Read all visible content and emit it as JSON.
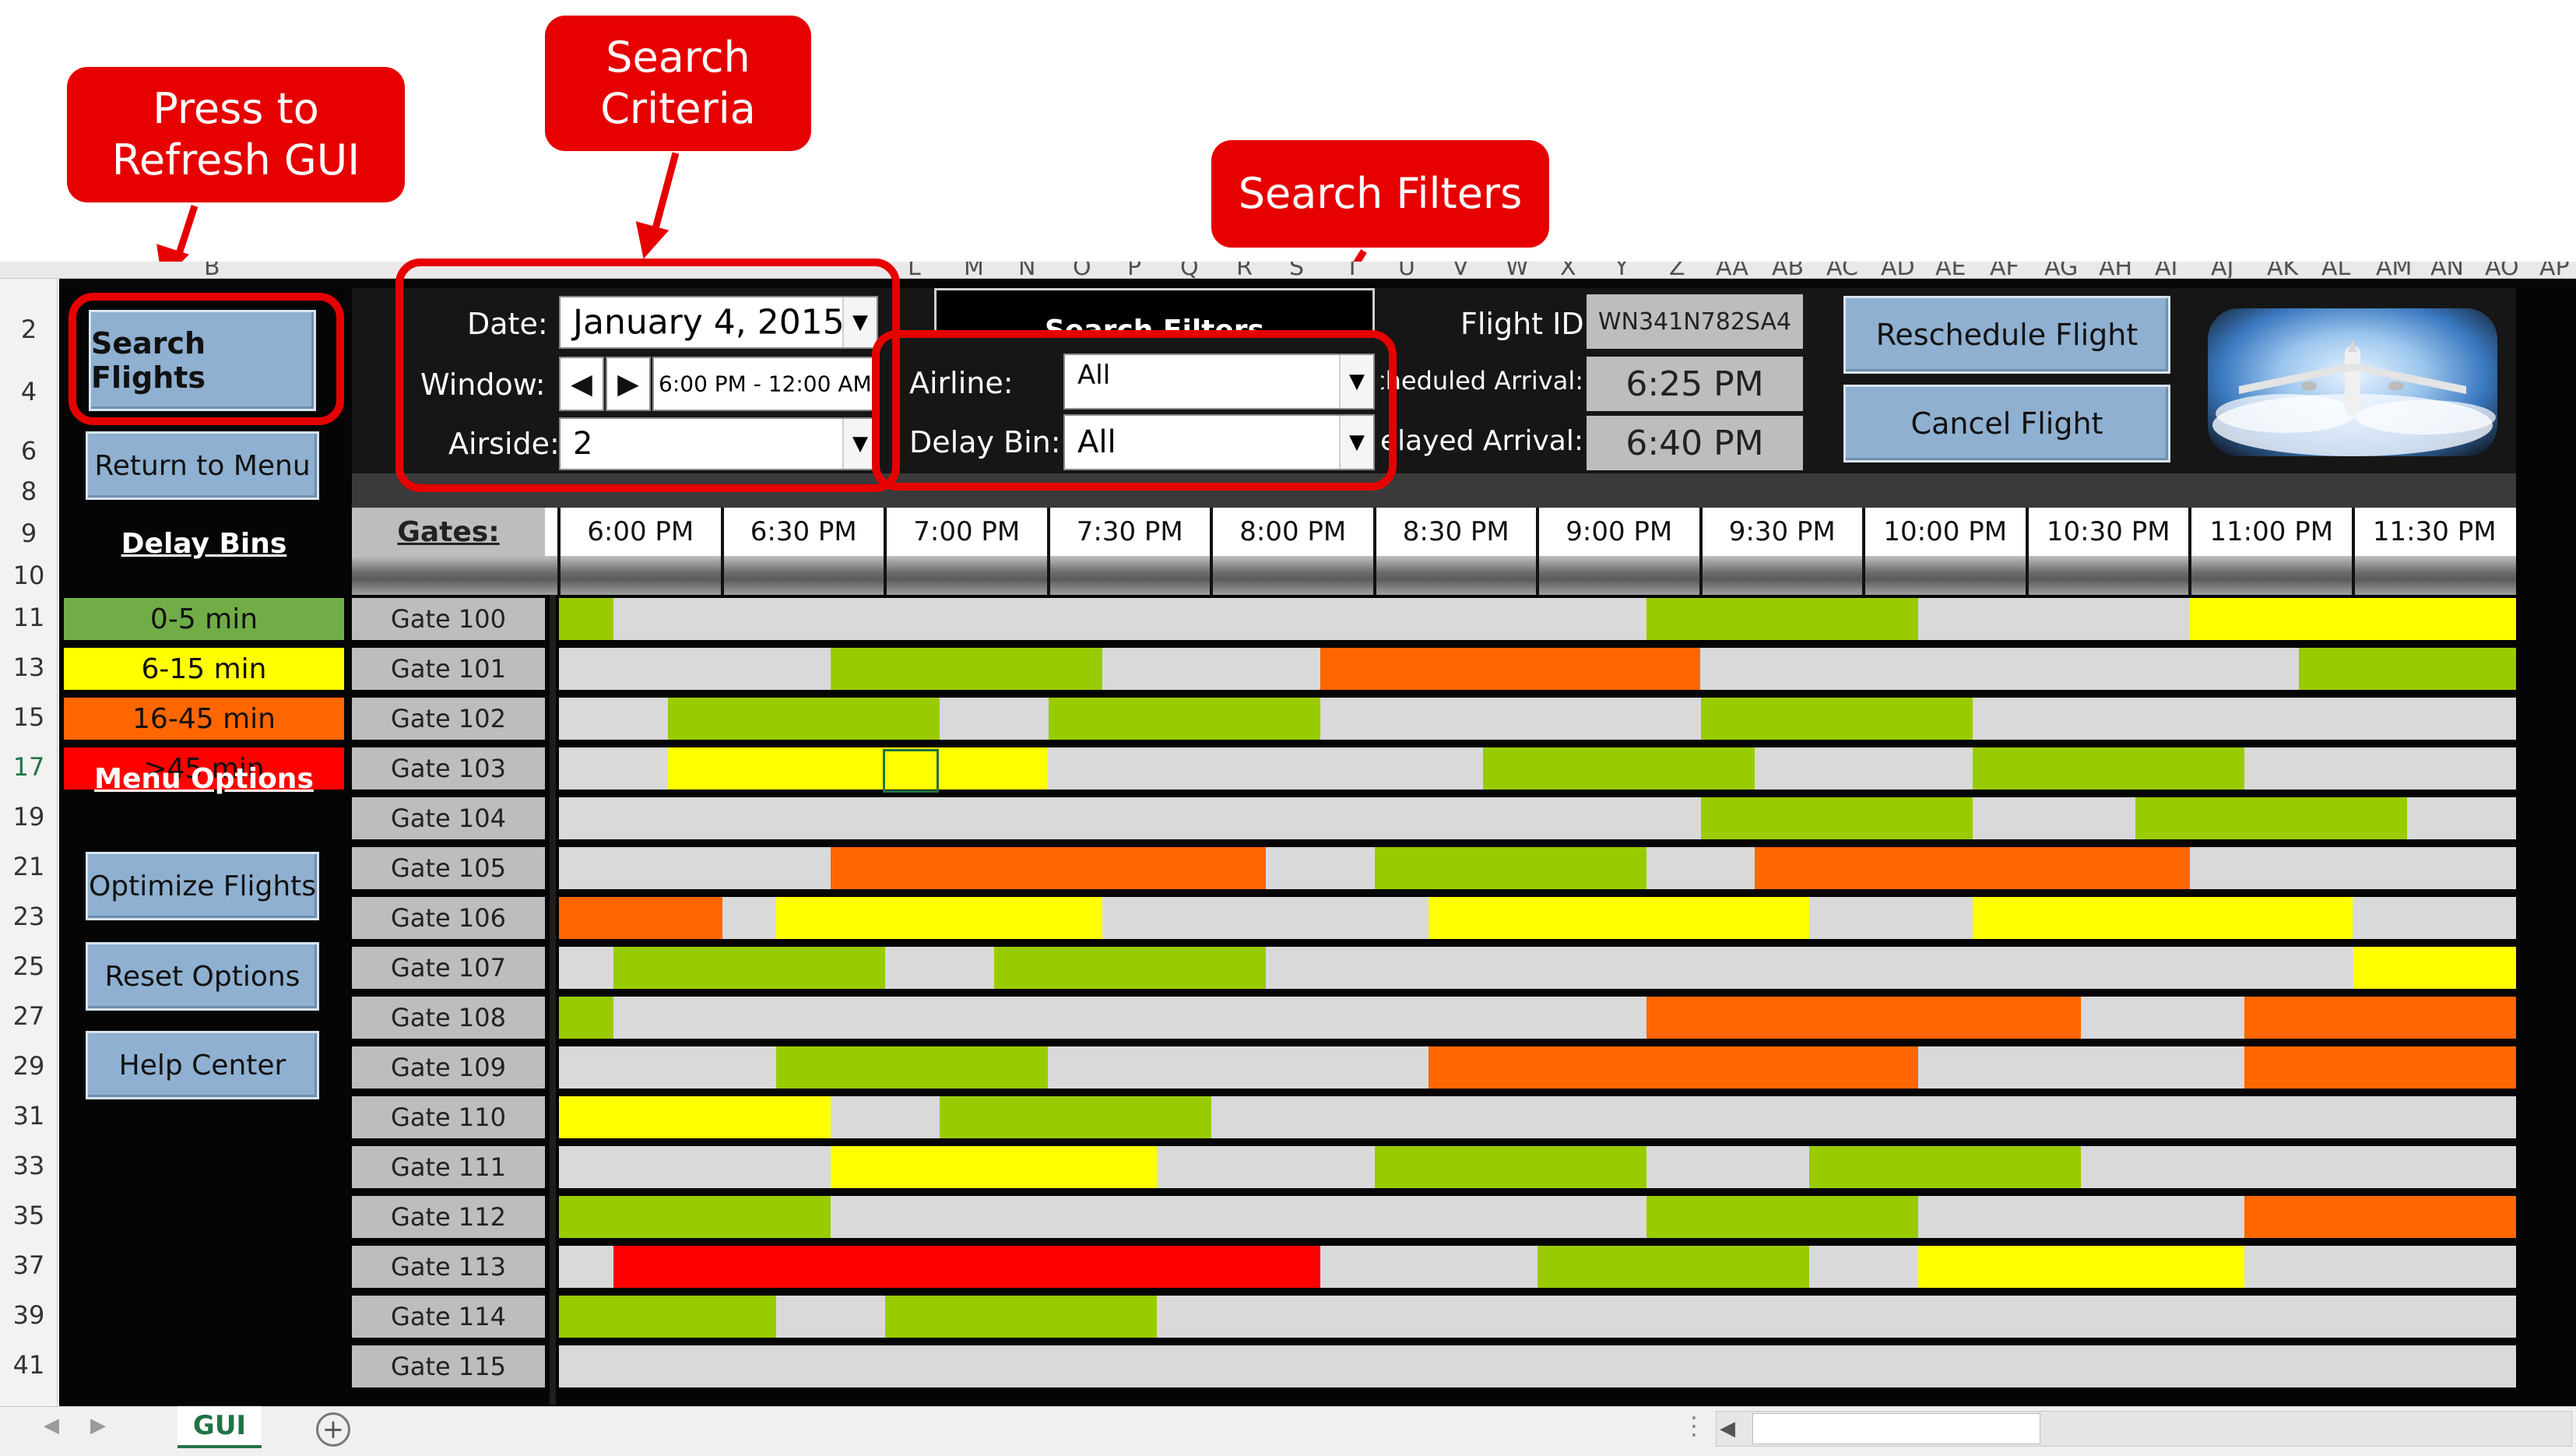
{
  "callouts": {
    "refresh": "Press to\nRefresh GUI",
    "criteria": "Search\nCriteria",
    "filters": "Search Filters"
  },
  "column_letters": [
    "B",
    "L",
    "M",
    "N",
    "O",
    "P",
    "Q",
    "R",
    "S",
    "T",
    "U",
    "V",
    "W",
    "X",
    "Y",
    "Z",
    "AA",
    "AB",
    "AC",
    "AD",
    "AE",
    "AF",
    "AG",
    "AH",
    "AI",
    "AJ",
    "AK",
    "AL",
    "AM",
    "AN",
    "AO",
    "AP"
  ],
  "row_numbers": [
    "2",
    "4",
    "6",
    "8",
    "9",
    "10",
    "11",
    "13",
    "15",
    "17",
    "19",
    "21",
    "23",
    "25",
    "27",
    "29",
    "31",
    "33",
    "35",
    "37",
    "39",
    "41"
  ],
  "buttons": {
    "search_flights": "Search Flights",
    "return_to_menu": "Return to Menu",
    "reschedule_flight": "Reschedule Flight",
    "cancel_flight": "Cancel Flight",
    "optimize_flights": "Optimize Flights",
    "reset_options": "Reset Options",
    "help_center": "Help Center"
  },
  "criteria": {
    "date_label": "Date:",
    "date_value": "January 4, 2015",
    "window_label": "Window:",
    "window_value": "6:00 PM - 12:00 AM",
    "airside_label": "Airside:",
    "airside_value": "2"
  },
  "filters": {
    "header": "Search Filters",
    "airline_label": "Airline:",
    "airline_value": "All",
    "delay_bin_label": "Delay Bin:",
    "delay_bin_value": "All"
  },
  "flight_info": {
    "flight_id_label": "Flight ID:",
    "flight_id_value": "WN341N782SA4",
    "scheduled_label": "Scheduled Arrival:",
    "scheduled_value": "6:25 PM",
    "delayed_label": "Delayed Arrival:",
    "delayed_value": "6:40 PM"
  },
  "delay_bins": {
    "title": "Delay Bins",
    "items": [
      {
        "label": "0-5 min",
        "color": "#70ad47"
      },
      {
        "label": "6-15 min",
        "color": "#ffff00"
      },
      {
        "label": "16-45 min",
        "color": "#ff6600"
      },
      {
        "label": ">45 min",
        "color": "#ff0000"
      }
    ]
  },
  "menu_options": {
    "title": "Menu Options"
  },
  "gantt": {
    "gates_header": "Gates:",
    "times": [
      "6:00 PM",
      "6:30 PM",
      "7:00 PM",
      "7:30 PM",
      "8:00 PM",
      "8:30 PM",
      "9:00 PM",
      "9:30 PM",
      "10:00 PM",
      "10:30 PM",
      "11:00 PM",
      "11:30 PM"
    ],
    "colors": {
      "green": "#99cc00",
      "yellow": "#ffff00",
      "orange": "#ff6600",
      "red": "#ff0000",
      "lane": "#d9d9d9"
    },
    "gates": [
      {
        "label": "Gate  100",
        "flights": [
          {
            "start": 0,
            "end": 10,
            "c": "green"
          },
          {
            "start": 200,
            "end": 250,
            "c": "green"
          },
          {
            "start": 300,
            "end": 360,
            "c": "yellow"
          }
        ]
      },
      {
        "label": "Gate  101",
        "flights": [
          {
            "start": 50,
            "end": 100,
            "c": "green"
          },
          {
            "start": 140,
            "end": 210,
            "c": "orange"
          },
          {
            "start": 320,
            "end": 360,
            "c": "green"
          }
        ]
      },
      {
        "label": "Gate  102",
        "flights": [
          {
            "start": 20,
            "end": 70,
            "c": "green"
          },
          {
            "start": 90,
            "end": 140,
            "c": "green"
          },
          {
            "start": 210,
            "end": 260,
            "c": "green"
          }
        ]
      },
      {
        "label": "Gate  103",
        "flights": [
          {
            "start": 20,
            "end": 90,
            "c": "yellow"
          },
          {
            "start": 170,
            "end": 220,
            "c": "green"
          },
          {
            "start": 260,
            "end": 310,
            "c": "green"
          }
        ]
      },
      {
        "label": "Gate  104",
        "flights": [
          {
            "start": 210,
            "end": 260,
            "c": "green"
          },
          {
            "start": 290,
            "end": 340,
            "c": "green"
          }
        ]
      },
      {
        "label": "Gate  105",
        "flights": [
          {
            "start": 50,
            "end": 130,
            "c": "orange"
          },
          {
            "start": 150,
            "end": 200,
            "c": "green"
          },
          {
            "start": 220,
            "end": 300,
            "c": "orange"
          }
        ]
      },
      {
        "label": "Gate  106",
        "flights": [
          {
            "start": 0,
            "end": 30,
            "c": "orange"
          },
          {
            "start": 40,
            "end": 100,
            "c": "yellow"
          },
          {
            "start": 160,
            "end": 230,
            "c": "yellow"
          },
          {
            "start": 260,
            "end": 330,
            "c": "yellow"
          }
        ]
      },
      {
        "label": "Gate  107",
        "flights": [
          {
            "start": 10,
            "end": 60,
            "c": "green"
          },
          {
            "start": 80,
            "end": 130,
            "c": "green"
          },
          {
            "start": 330,
            "end": 360,
            "c": "yellow"
          }
        ]
      },
      {
        "label": "Gate  108",
        "flights": [
          {
            "start": 0,
            "end": 10,
            "c": "green"
          },
          {
            "start": 200,
            "end": 280,
            "c": "orange"
          },
          {
            "start": 310,
            "end": 360,
            "c": "orange"
          }
        ]
      },
      {
        "label": "Gate  109",
        "flights": [
          {
            "start": 40,
            "end": 90,
            "c": "green"
          },
          {
            "start": 160,
            "end": 250,
            "c": "orange"
          },
          {
            "start": 310,
            "end": 360,
            "c": "orange"
          }
        ]
      },
      {
        "label": "Gate  110",
        "flights": [
          {
            "start": 0,
            "end": 50,
            "c": "yellow"
          },
          {
            "start": 70,
            "end": 120,
            "c": "green"
          }
        ]
      },
      {
        "label": "Gate  111",
        "flights": [
          {
            "start": 50,
            "end": 110,
            "c": "yellow"
          },
          {
            "start": 150,
            "end": 200,
            "c": "green"
          },
          {
            "start": 230,
            "end": 280,
            "c": "green"
          }
        ]
      },
      {
        "label": "Gate  112",
        "flights": [
          {
            "start": 0,
            "end": 50,
            "c": "green"
          },
          {
            "start": 200,
            "end": 250,
            "c": "green"
          },
          {
            "start": 310,
            "end": 360,
            "c": "orange"
          }
        ]
      },
      {
        "label": "Gate  113",
        "flights": [
          {
            "start": 10,
            "end": 140,
            "c": "red"
          },
          {
            "start": 180,
            "end": 230,
            "c": "green"
          },
          {
            "start": 250,
            "end": 310,
            "c": "yellow"
          }
        ]
      },
      {
        "label": "Gate  114",
        "flights": [
          {
            "start": 0,
            "end": 40,
            "c": "green"
          },
          {
            "start": 60,
            "end": 110,
            "c": "green"
          }
        ]
      },
      {
        "label": "Gate  115",
        "flights": []
      }
    ]
  },
  "sheet_tab": "GUI"
}
